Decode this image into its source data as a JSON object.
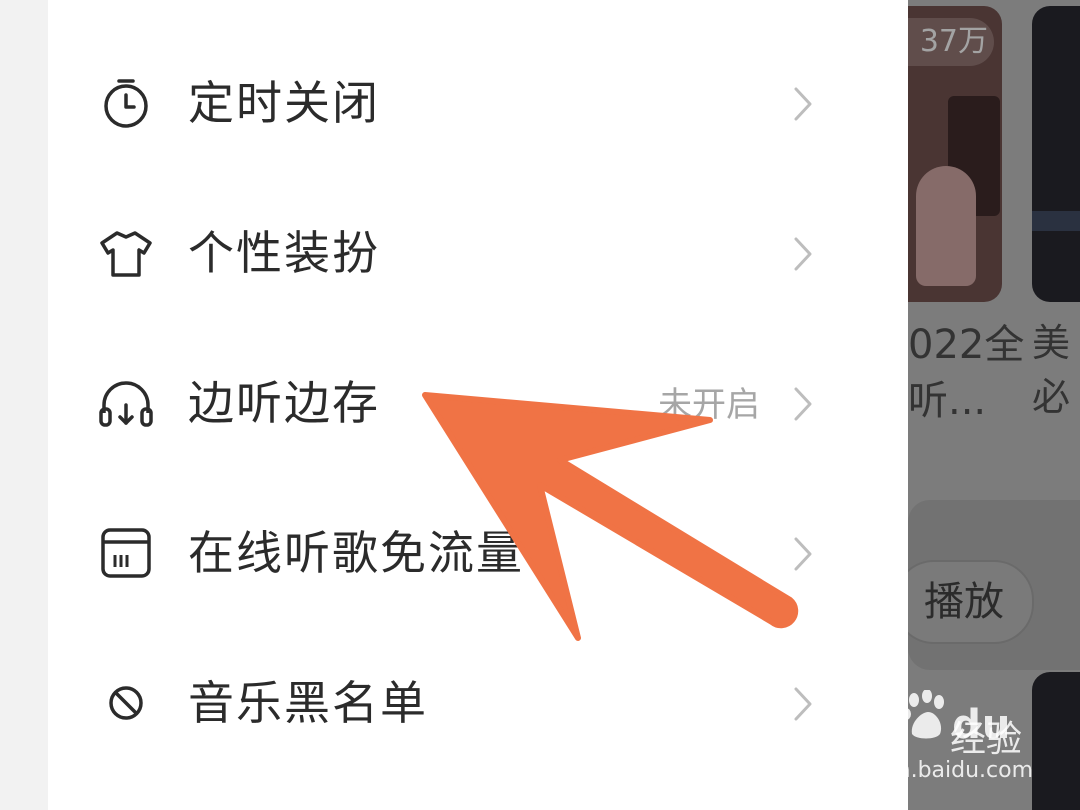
{
  "menu": {
    "items": [
      {
        "label": "定时关闭",
        "value": "",
        "icon": "timer-icon"
      },
      {
        "label": "个性装扮",
        "value": "",
        "icon": "tshirt-icon"
      },
      {
        "label": "边听边存",
        "value": "未开启",
        "icon": "headphones-icon"
      },
      {
        "label": "在线听歌免流量",
        "value": "",
        "icon": "sim-card-icon"
      },
      {
        "label": "音乐黑名单",
        "value": "",
        "icon": "block-icon"
      }
    ]
  },
  "background": {
    "play_count": "37万",
    "card1_title_line1": "022全",
    "card1_title_line2": "听...",
    "card2_title_line1": "美",
    "card2_title_line2": "必",
    "play_button": "播放"
  },
  "annotation": {
    "arrow_color": "#f07345"
  },
  "watermark": {
    "brand": "Bai",
    "brand_suffix": "du",
    "product": "经验",
    "url": "jingyan.baidu.com"
  }
}
